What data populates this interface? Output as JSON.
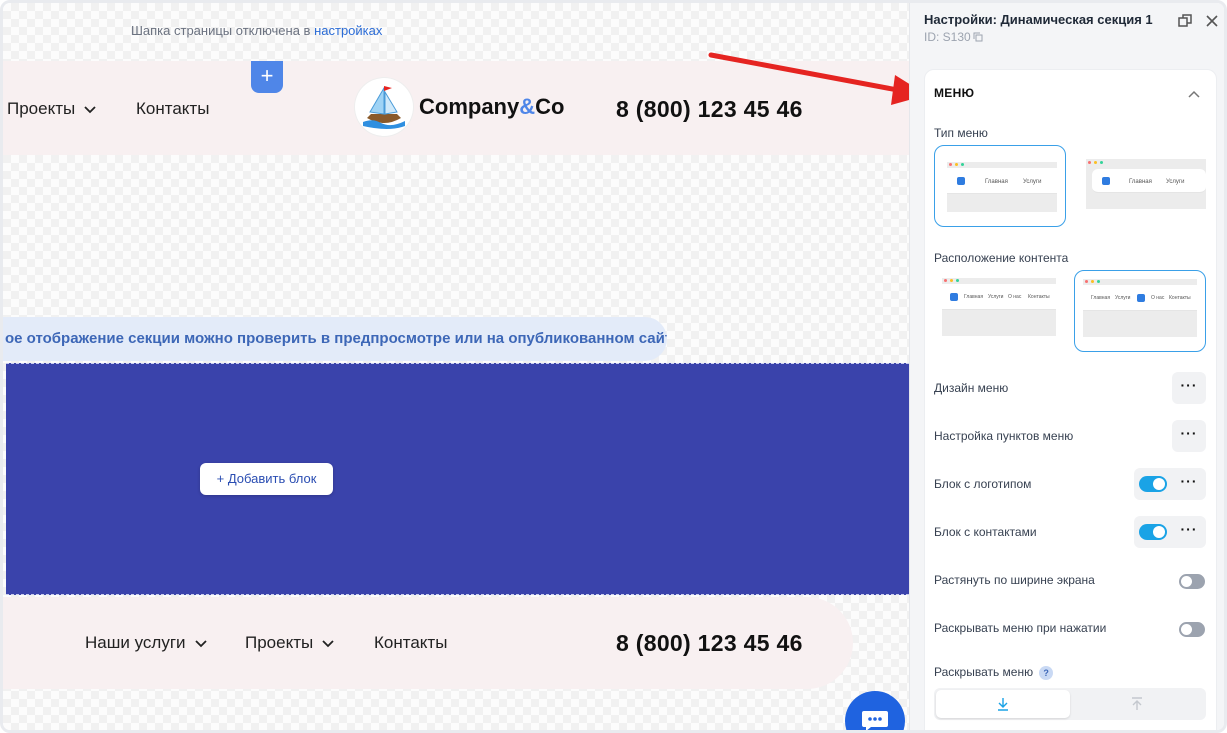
{
  "canvas": {
    "notice_text": "Шапка страницы отключена в",
    "notice_link": "настройках",
    "add_section_icon": "+",
    "header": {
      "nav_projects": "Проекты",
      "nav_contacts": "Контакты",
      "logo_name": "Company",
      "logo_amp": "&",
      "logo_suffix": "Co",
      "phone": "8 (800) 123 45 46"
    },
    "info_pill": "ое отображение секции можно проверить в предпросмотре или на опубликованном сайте",
    "add_block": "+ Добавить блок",
    "footer_header": {
      "nav_services": "Наши услуги",
      "nav_projects": "Проекты",
      "nav_contacts": "Контакты",
      "phone": "8 (800) 123 45 46"
    }
  },
  "panel": {
    "title": "Настройки: Динамическая секция 1",
    "id_label": "ID: S130",
    "section_title": "МЕНЮ",
    "menu_type_label": "Тип меню",
    "menu_type_thumb_1": {
      "item_1": "Главная",
      "item_2": "Услуги"
    },
    "menu_type_thumb_2": {
      "item_1": "Главная",
      "item_2": "Услуги"
    },
    "content_layout_label": "Расположение контента",
    "layout_thumb_1": {
      "items": [
        "Главная",
        "Услуги",
        "О нас",
        "Контакты"
      ]
    },
    "layout_thumb_2": {
      "items": [
        "Главная",
        "Услуги",
        "О нас",
        "Контакты"
      ]
    },
    "design_label": "Дизайн меню",
    "items_setup_label": "Настройка пунктов меню",
    "logo_block_label": "Блок с логотипом",
    "logo_block_on": true,
    "contacts_block_label": "Блок с контактами",
    "contacts_block_on": true,
    "stretch_label": "Растянуть по ширине экрана",
    "stretch_on": false,
    "expand_click_label": "Раскрывать меню при нажатии",
    "expand_click_on": false,
    "expand_label": "Раскрывать меню",
    "expand_help": "?",
    "more_icon": "···"
  },
  "colors": {
    "accent": "#1aa3e6",
    "section_blue": "#3a43ab",
    "header_pink": "#f8f0f1",
    "arrow_red": "#e52421"
  }
}
